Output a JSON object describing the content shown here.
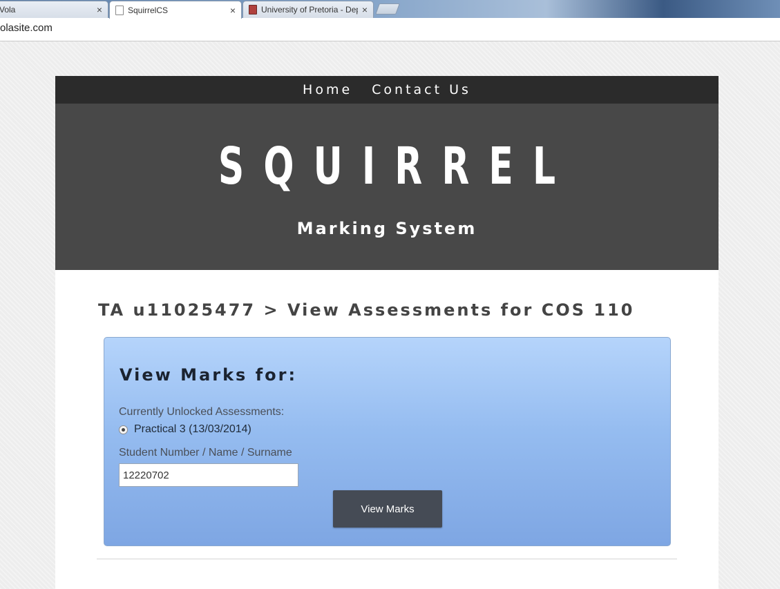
{
  "browser": {
    "tabs": [
      {
        "label": "Vola",
        "active": false
      },
      {
        "label": "SquirrelCS",
        "active": true
      },
      {
        "label": "University of Pretoria - Dep",
        "active": false
      }
    ],
    "close_glyph": "×",
    "url": "olasite.com"
  },
  "nav": {
    "items": [
      {
        "label": "Home"
      },
      {
        "label": "Contact Us"
      }
    ]
  },
  "banner": {
    "title": "SQUIRREL",
    "subtitle": "Marking System"
  },
  "breadcrumb": "TA u11025477 > View Assessments for COS 110",
  "form": {
    "title": "View Marks for:",
    "assessments_label": "Currently Unlocked Assessments:",
    "assessment_option": "Practical 3 (13/03/2014)",
    "search_label": "Student Number / Name / Surname",
    "search_value": "12220702",
    "submit_label": "View Marks"
  }
}
